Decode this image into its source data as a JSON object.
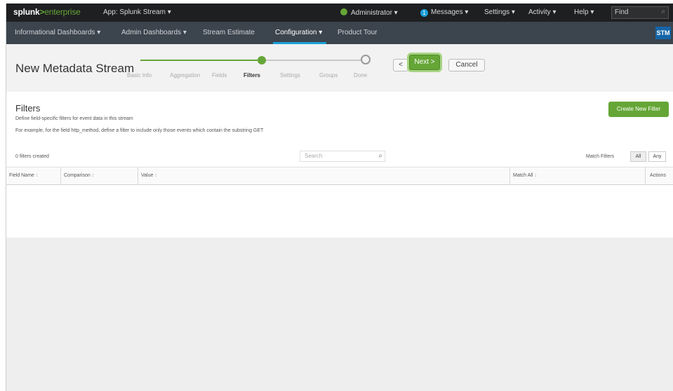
{
  "topbar": {
    "logo_splunk": "splunk",
    "logo_gt": ">",
    "logo_enterprise": "enterprise",
    "app_menu": "App: Splunk Stream ▾",
    "administrator": "Administrator ▾",
    "messages_count": "1",
    "messages": "Messages ▾",
    "settings": "Settings ▾",
    "activity": "Activity ▾",
    "help": "Help ▾",
    "find_placeholder": "Find",
    "find_icon": "search-icon"
  },
  "appbar": {
    "items": [
      {
        "label": "Informational Dashboards ▾"
      },
      {
        "label": "Admin Dashboards ▾"
      },
      {
        "label": "Stream Estimate"
      },
      {
        "label": "Configuration ▾"
      },
      {
        "label": "Product Tour"
      }
    ],
    "active_item": "Configuration",
    "badge": "STM",
    "accent_color": "#1a9fd9"
  },
  "wizard": {
    "title": "New Metadata Stream",
    "steps": [
      {
        "label": "Basic Info",
        "state": "complete"
      },
      {
        "label": "Aggregation",
        "state": "complete"
      },
      {
        "label": "Fields",
        "state": "complete"
      },
      {
        "label": "Filters",
        "state": "current"
      },
      {
        "label": "Settings",
        "state": "pending"
      },
      {
        "label": "Groups",
        "state": "pending"
      },
      {
        "label": "Done",
        "state": "pending"
      }
    ],
    "prev_label": "<",
    "next_label": "Next >",
    "cancel_label": "Cancel",
    "progress_color": "#65a637"
  },
  "filters": {
    "title": "Filters",
    "description_1": "Define field-specific filters for event data in this stream",
    "description_2": "For example, for the field http_method, define a filter to include only those events which contain the substring GET",
    "create_button": "Create New Filter",
    "count_text": "0 filters created",
    "search_placeholder": "Search",
    "match_label": "Match Filters",
    "match_options": [
      "All",
      "Any"
    ],
    "match_selected": "All"
  },
  "table": {
    "columns": [
      "Field Name",
      "Comparison",
      "Value",
      "Match All",
      "Actions"
    ],
    "sort_glyph": "↕",
    "rows": []
  }
}
